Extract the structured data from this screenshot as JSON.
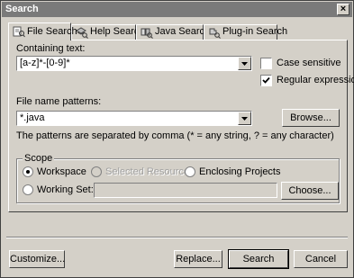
{
  "window": {
    "title": "Search",
    "close_label": "×"
  },
  "tabs": [
    {
      "label": "File Search",
      "icon": "file-search-icon",
      "active": true
    },
    {
      "label": "Help Search",
      "icon": "help-search-icon",
      "active": false
    },
    {
      "label": "Java Search",
      "icon": "java-search-icon",
      "active": false
    },
    {
      "label": "Plug-in Search",
      "icon": "plugin-search-icon",
      "active": false
    }
  ],
  "containing_text": {
    "label": "Containing text:",
    "value": "[a-z]*-[0-9]*"
  },
  "options": {
    "case_sensitive": {
      "label": "Case sensitive",
      "checked": false
    },
    "regular_expression": {
      "label": "Regular expression",
      "checked": true
    }
  },
  "file_name_patterns": {
    "label": "File name patterns:",
    "value": "*.java",
    "browse_label": "Browse...",
    "hint": "The patterns are separated by comma (* = any string, ? = any character)"
  },
  "scope": {
    "title": "Scope",
    "workspace": {
      "label": "Workspace",
      "checked": true
    },
    "selected_resources": {
      "label": "Selected Resources",
      "enabled": false
    },
    "enclosing_projects": {
      "label": "Enclosing Projects",
      "checked": false
    },
    "working_set": {
      "label": "Working Set:",
      "value": "",
      "choose_label": "Choose..."
    }
  },
  "footer": {
    "customize_label": "Customize...",
    "replace_label": "Replace...",
    "search_label": "Search",
    "cancel_label": "Cancel"
  },
  "colors": {
    "titlebar": "#7a7a7a",
    "face": "#d4d0c8"
  }
}
